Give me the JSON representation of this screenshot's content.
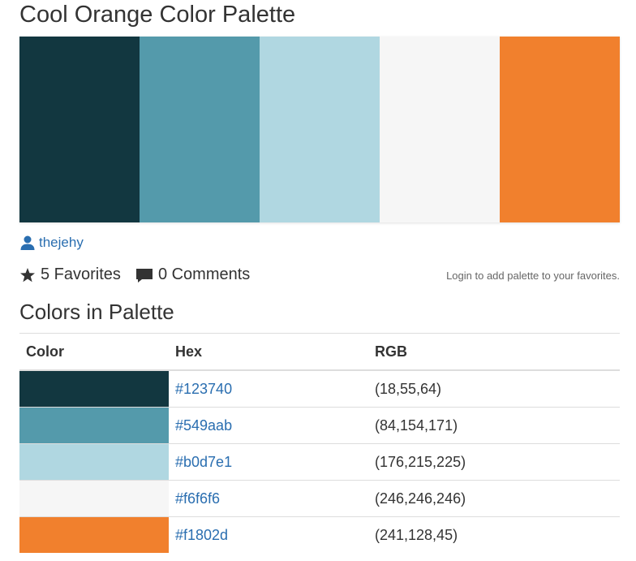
{
  "title": "Cool Orange Color Palette",
  "palette": [
    {
      "hex": "#123740"
    },
    {
      "hex": "#549aab"
    },
    {
      "hex": "#b0d7e1"
    },
    {
      "hex": "#f6f6f6"
    },
    {
      "hex": "#f1802d"
    }
  ],
  "author": {
    "icon": "user-icon",
    "name": "thejehy"
  },
  "stats": {
    "favorites_icon": "star-icon",
    "favorites": "5 Favorites",
    "comments_icon": "comment-icon",
    "comments": "0 Comments"
  },
  "login_note": "Login to add palette to your favorites.",
  "section_title": "Colors in Palette",
  "table": {
    "headers": [
      "Color",
      "Hex",
      "RGB"
    ],
    "rows": [
      {
        "color": "#123740",
        "hex": "#123740",
        "rgb": "(18,55,64)"
      },
      {
        "color": "#549aab",
        "hex": "#549aab",
        "rgb": "(84,154,171)"
      },
      {
        "color": "#b0d7e1",
        "hex": "#b0d7e1",
        "rgb": "(176,215,225)"
      },
      {
        "color": "#f6f6f6",
        "hex": "#f6f6f6",
        "rgb": "(246,246,246)"
      },
      {
        "color": "#f1802d",
        "hex": "#f1802d",
        "rgb": "(241,128,45)"
      }
    ]
  },
  "colors": {
    "link": "#2a6eb0",
    "text": "#333333",
    "muted": "#666666"
  }
}
